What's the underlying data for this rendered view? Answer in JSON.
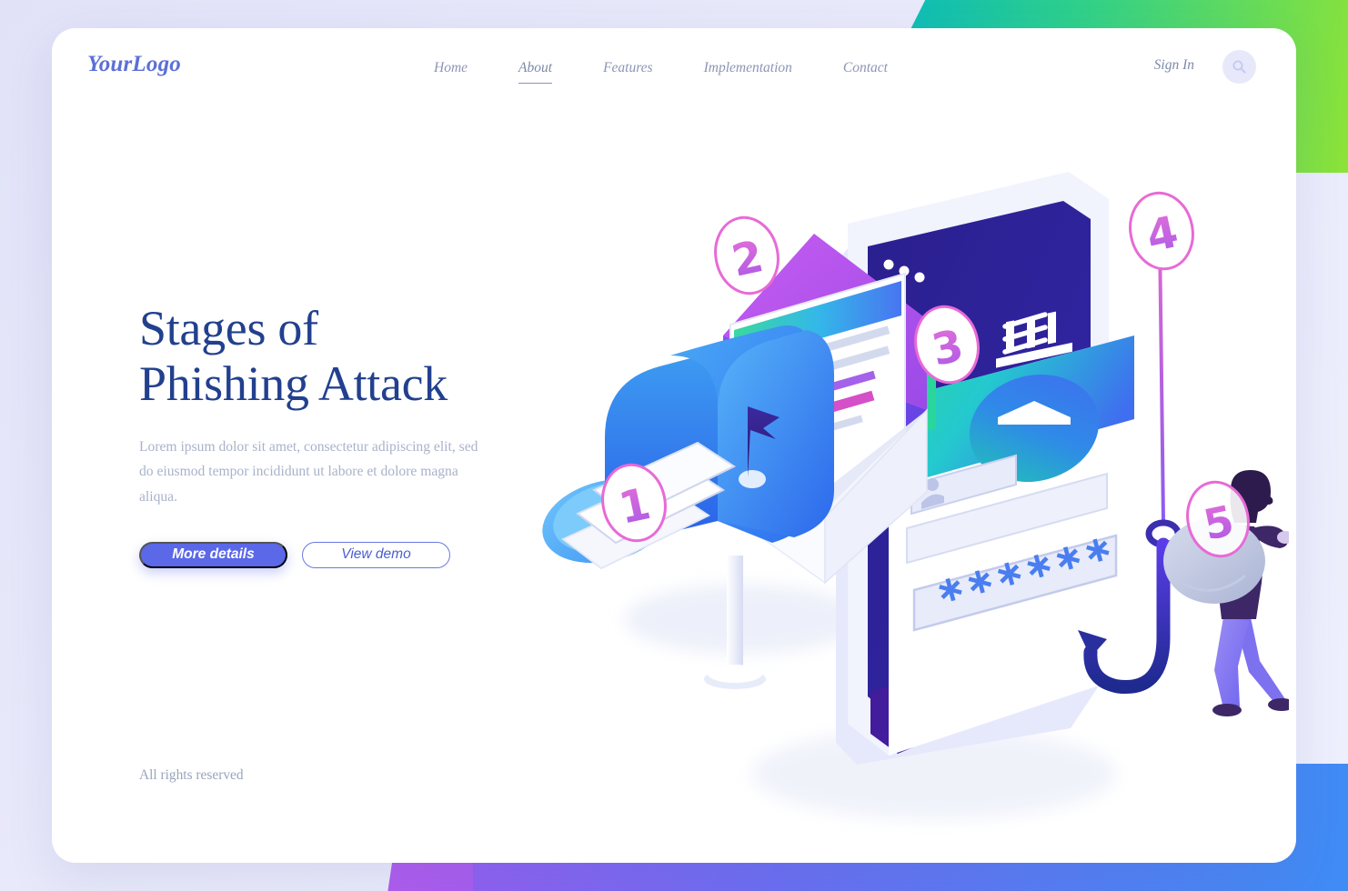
{
  "brand": {
    "logo": "YourLogo",
    "accent": "#5b68e8",
    "title_color": "#22408e",
    "badge_color": "#d664c8"
  },
  "nav": {
    "items": [
      {
        "label": "Home",
        "active": false
      },
      {
        "label": "About",
        "active": true
      },
      {
        "label": "Features",
        "active": false
      },
      {
        "label": "Implementation",
        "active": false
      },
      {
        "label": "Contact",
        "active": false
      }
    ],
    "signin_label": "Sign In",
    "search_icon": "search-icon"
  },
  "hero": {
    "title_line1": "Stages of",
    "title_line2": "Phishing Attack",
    "paragraph": "Lorem ipsum dolor sit amet, consectetur adipiscing elit, sed do eiusmod tempor incididunt ut labore et dolore magna aliqua.",
    "primary_button": "More details",
    "secondary_button": "View demo"
  },
  "footer": {
    "rights": "All rights reserved"
  },
  "illustration": {
    "name": "phishing-attack-isometric-illustration",
    "stage_badges": [
      {
        "number": "1",
        "target": "mailbox"
      },
      {
        "number": "2",
        "target": "email-envelope"
      },
      {
        "number": "3",
        "target": "phone-bank-app"
      },
      {
        "number": "4",
        "target": "fishing-hook"
      },
      {
        "number": "5",
        "target": "thief-with-sack"
      }
    ],
    "phone": {
      "password_mask": "∗∗∗∗∗∗",
      "menu_icon": "hamburger-menu-icon",
      "dots_icon": "three-dots-icon",
      "bank_icon": "bank-building-icon",
      "user_icon": "user-avatar-icon"
    },
    "letter": {
      "bank_icon": "bank-building-icon"
    },
    "mailbox": {
      "flag_icon": "mailbox-flag-icon",
      "envelope_icon": "envelope-icon"
    }
  },
  "background": {
    "top_band_gradient": [
      "#00b5c8",
      "#8de337"
    ],
    "bottom_band_gradient": [
      "#c558e8",
      "#3f8cf5"
    ],
    "page_bg": "#e3e4f8"
  }
}
